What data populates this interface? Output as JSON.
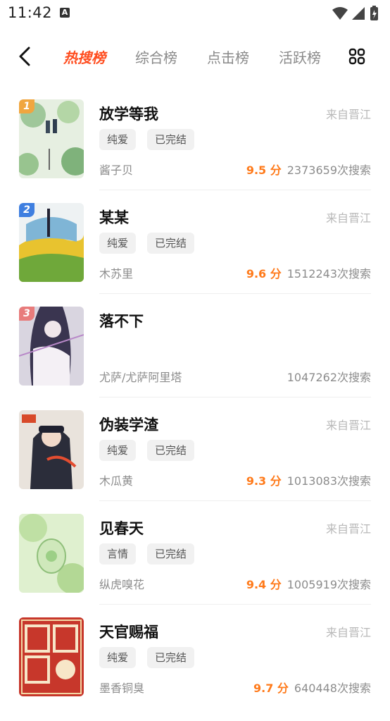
{
  "status_bar": {
    "time": "11:42",
    "notif_icon": "A"
  },
  "nav": {
    "tabs": [
      "热搜榜",
      "综合榜",
      "点击榜",
      "活跃榜"
    ],
    "active_tab": 0,
    "accent": "#ff4d1f"
  },
  "books": [
    {
      "rank": "1",
      "title": "放学等我",
      "source": "来自晋江",
      "tags": [
        "纯爱",
        "已完结"
      ],
      "author": "酱子贝",
      "score": "9.5 分",
      "searches": "2373659次搜索",
      "rank_color": "#f0a640"
    },
    {
      "rank": "2",
      "title": "某某",
      "source": "来自晋江",
      "tags": [
        "纯爱",
        "已完结"
      ],
      "author": "木苏里",
      "score": "9.6 分",
      "searches": "1512243次搜索",
      "rank_color": "#3f7fe0"
    },
    {
      "rank": "3",
      "title": "落不下",
      "source": "",
      "tags": [],
      "author": "尤萨/尤萨阿里塔",
      "score": "",
      "searches": "1047262次搜索",
      "rank_color": "#e87b7b"
    },
    {
      "rank": "",
      "title": "伪装学渣",
      "source": "来自晋江",
      "tags": [
        "纯爱",
        "已完结"
      ],
      "author": "木瓜黄",
      "score": "9.3 分",
      "searches": "1013083次搜索",
      "rank_color": ""
    },
    {
      "rank": "",
      "title": "见春天",
      "source": "来自晋江",
      "tags": [
        "言情",
        "已完结"
      ],
      "author": "纵虎嗅花",
      "score": "9.4 分",
      "searches": "1005919次搜索",
      "rank_color": ""
    },
    {
      "rank": "",
      "title": "天官赐福",
      "source": "来自晋江",
      "tags": [
        "纯爱",
        "已完结"
      ],
      "author": "墨香铜臭",
      "score": "9.7 分",
      "searches": "640448次搜索",
      "rank_color": ""
    }
  ]
}
